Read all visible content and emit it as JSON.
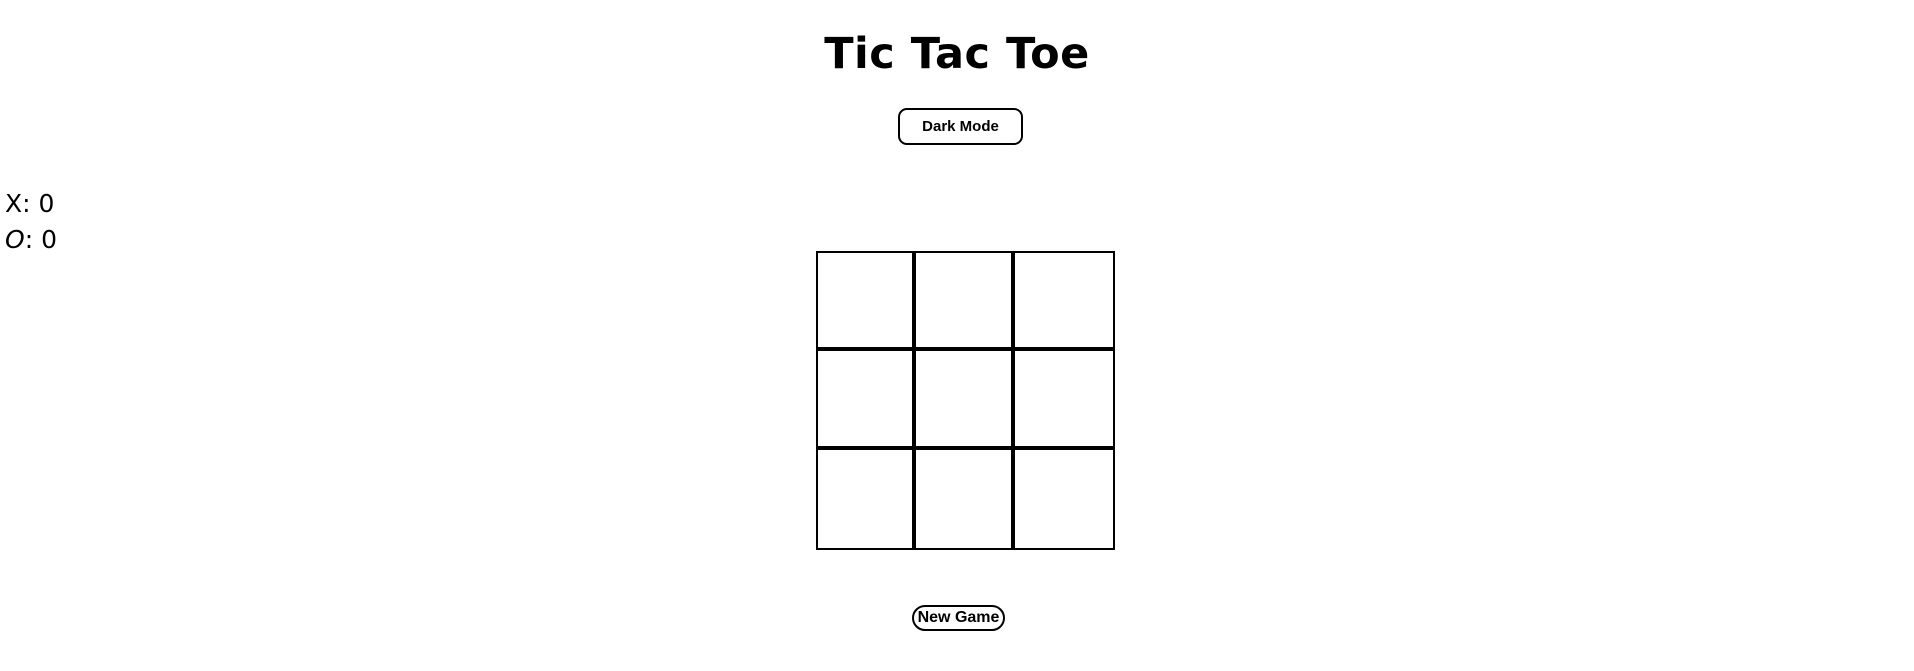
{
  "header": {
    "title": "Tic Tac Toe"
  },
  "controls": {
    "dark_mode_label": "Dark Mode",
    "new_game_label": "New Game"
  },
  "scores": {
    "x_label": "X",
    "x_value": "0",
    "o_label": "O",
    "o_value": "0",
    "separator": ": "
  },
  "board": {
    "cells": [
      "",
      "",
      "",
      "",
      "",
      "",
      "",
      "",
      ""
    ]
  },
  "colors": {
    "background": "#ffffff",
    "foreground": "#000000"
  }
}
